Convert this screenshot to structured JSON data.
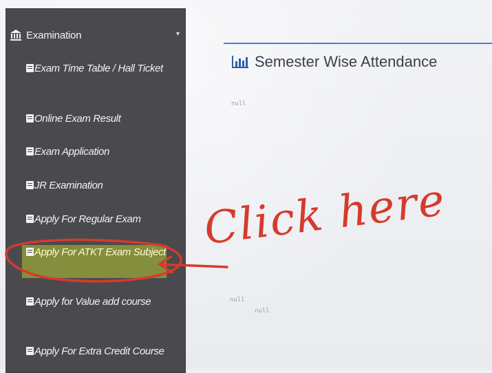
{
  "sidebar": {
    "section_label": "Examination",
    "items": [
      {
        "label": "Exam Time Table / Hall Ticket"
      },
      {
        "label": "Online Exam Result"
      },
      {
        "label": "Exam Application"
      },
      {
        "label": "JR Examination"
      },
      {
        "label": "Apply For Regular Exam"
      },
      {
        "label": "Apply For ATKT Exam Subject"
      },
      {
        "label": "Apply for Value add course"
      },
      {
        "label": "Apply For Extra Credit Course"
      }
    ]
  },
  "main": {
    "title": "Semester Wise Attendance",
    "null_1": "null",
    "null_2": "null",
    "null_3": "null"
  },
  "annotation": {
    "text": "Click here",
    "color": "#d63a2c"
  },
  "colors": {
    "sidebar_bg": "#4a4a4e",
    "accent_line": "#4b7ed3",
    "highlight": "#8e9a3a"
  }
}
